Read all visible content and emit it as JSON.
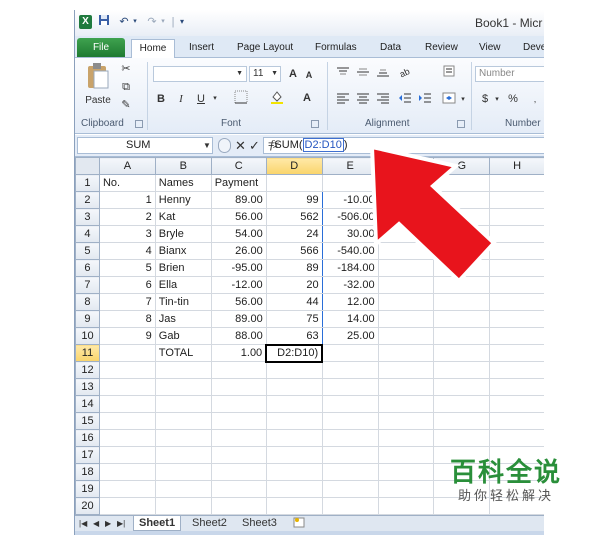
{
  "title_bar": {
    "title": "Book1 - Micr",
    "logo": "X",
    "quick_access": [
      "save-icon",
      "undo-icon",
      "redo-icon",
      "customize-icon"
    ]
  },
  "ribbon_tabs": [
    "File",
    "Home",
    "Insert",
    "Page Layout",
    "Formulas",
    "Data",
    "Review",
    "View",
    "Deve"
  ],
  "ribbon": {
    "clipboard": {
      "paste_label": "Paste",
      "group_label": "Clipboard"
    },
    "font": {
      "size_value": "11",
      "bold": "B",
      "italic": "I",
      "underline": "U",
      "group_label": "Font",
      "grow": "A",
      "shrink": "A",
      "color": "A"
    },
    "alignment": {
      "group_label": "Alignment"
    },
    "number": {
      "format_placeholder": "Number",
      "currency": "$",
      "percent": "%",
      "group_label": "Number"
    }
  },
  "formula_bar": {
    "name_box": "SUM",
    "cancel": "✕",
    "enter": "✓",
    "fx": "fx",
    "formula_prefix": "=SUM(",
    "formula_ref": "D2:D10",
    "formula_suffix": ")"
  },
  "columns": [
    "A",
    "B",
    "C",
    "D",
    "E",
    "F",
    "G",
    "H"
  ],
  "rows": [
    {
      "n": "1",
      "cells": [
        "No.",
        "Names",
        "Payment",
        "",
        "",
        "",
        "",
        ""
      ]
    },
    {
      "n": "2",
      "cells": [
        "1",
        "Henny",
        "89.00",
        "99",
        "-10.00",
        "",
        "",
        ""
      ]
    },
    {
      "n": "3",
      "cells": [
        "2",
        "Kat",
        "56.00",
        "562",
        "-506.00",
        "",
        "",
        ""
      ]
    },
    {
      "n": "4",
      "cells": [
        "3",
        "Bryle",
        "54.00",
        "24",
        "30.00",
        "",
        "",
        ""
      ]
    },
    {
      "n": "5",
      "cells": [
        "4",
        "Bianx",
        "26.00",
        "566",
        "-540.00",
        "",
        "",
        ""
      ]
    },
    {
      "n": "6",
      "cells": [
        "5",
        "Brien",
        "-95.00",
        "89",
        "-184.00",
        "",
        "",
        ""
      ]
    },
    {
      "n": "7",
      "cells": [
        "6",
        "Ella",
        "-12.00",
        "20",
        "-32.00",
        "",
        "",
        ""
      ]
    },
    {
      "n": "8",
      "cells": [
        "7",
        "Tin-tin",
        "56.00",
        "44",
        "12.00",
        "",
        "",
        ""
      ]
    },
    {
      "n": "9",
      "cells": [
        "8",
        "Jas",
        "89.00",
        "75",
        "14.00",
        "",
        "",
        ""
      ]
    },
    {
      "n": "10",
      "cells": [
        "9",
        "Gab",
        "88.00",
        "63",
        "25.00",
        "",
        "",
        ""
      ]
    },
    {
      "n": "11",
      "cells": [
        "",
        "TOTAL",
        "1.00",
        "D2:D10)",
        "",
        "",
        "",
        ""
      ]
    },
    {
      "n": "12",
      "cells": [
        "",
        "",
        "",
        "",
        "",
        "",
        "",
        ""
      ]
    },
    {
      "n": "13",
      "cells": [
        "",
        "",
        "",
        "",
        "",
        "",
        "",
        ""
      ]
    },
    {
      "n": "14",
      "cells": [
        "",
        "",
        "",
        "",
        "",
        "",
        "",
        ""
      ]
    },
    {
      "n": "15",
      "cells": [
        "",
        "",
        "",
        "",
        "",
        "",
        "",
        ""
      ]
    },
    {
      "n": "16",
      "cells": [
        "",
        "",
        "",
        "",
        "",
        "",
        "",
        ""
      ]
    },
    {
      "n": "17",
      "cells": [
        "",
        "",
        "",
        "",
        "",
        "",
        "",
        ""
      ]
    },
    {
      "n": "18",
      "cells": [
        "",
        "",
        "",
        "",
        "",
        "",
        "",
        ""
      ]
    },
    {
      "n": "19",
      "cells": [
        "",
        "",
        "",
        "",
        "",
        "",
        "",
        ""
      ]
    },
    {
      "n": "20",
      "cells": [
        "",
        "",
        "",
        "",
        "",
        "",
        "",
        ""
      ]
    }
  ],
  "sheet_tabs": [
    "Sheet1",
    "Sheet2",
    "Sheet3"
  ],
  "watermark": {
    "brand": "百科全说",
    "tagline": "助你轻松解决"
  },
  "colors": {
    "file_tab": "#1e7a31",
    "selection": "#2a6ed8",
    "arrow": "#e8141c",
    "watermark": "#2a8f3a"
  }
}
